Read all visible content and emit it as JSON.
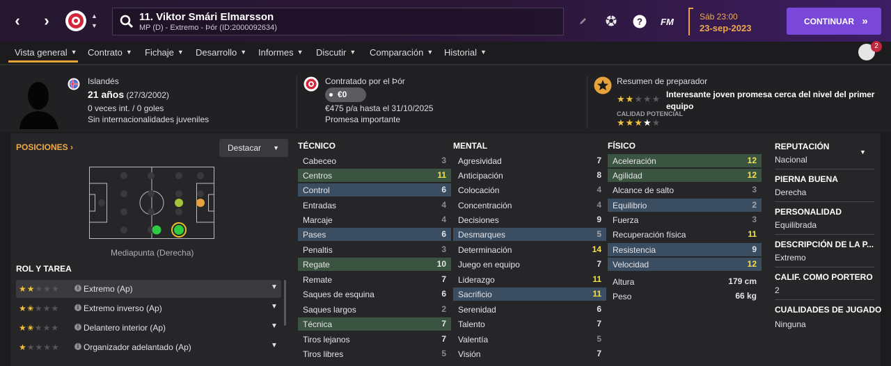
{
  "top": {
    "player_title": "11. Viktor Smári Elmarsson",
    "player_sub": "MP (D) - Extremo - Þór (ID:2000092634)",
    "fm_logo": "FM",
    "date_day": "Sáb 23:00",
    "date_full": "23-sep-2023",
    "continue_label": "CONTINUAR",
    "notifications": "2",
    "colors": {
      "accent": "#7a48d8",
      "date": "#f0a94a"
    }
  },
  "tabs": [
    "Vista general",
    "Contrato",
    "Fichaje",
    "Desarrollo",
    "Informes",
    "Discutir",
    "Comparación",
    "Historial"
  ],
  "info": {
    "nationality": "Islandés",
    "age": "21 años",
    "birth": "(27/3/2002)",
    "caps": "0 veces int. / 0 goles",
    "youth": "Sin internacionalidades juveniles",
    "contracted_by": "Contratado por el Þór",
    "fee": "€0",
    "wage": "€475 p/a hasta el 31/10/2025",
    "status": "Promesa importante",
    "coach_title": "Resumen de preparador",
    "coach_summary": "Interesante joven promesa cerca del nivel del primer equipo",
    "potential_label": "CALIDAD POTENCIAL",
    "current_stars": 2,
    "potential_stars": 3.5
  },
  "positions": {
    "header": "POSICIONES",
    "destacar": "Destacar",
    "label": "Mediapunta (Derecha)"
  },
  "roles": {
    "header": "ROL Y TAREA",
    "items": [
      {
        "name": "Extremo (Ap)",
        "stars": 2
      },
      {
        "name": "Extremo inverso (Ap)",
        "stars": 1.5
      },
      {
        "name": "Delantero interior (Ap)",
        "stars": 1.5
      },
      {
        "name": "Organizador adelantado (Ap)",
        "stars": 1
      }
    ]
  },
  "tecnico": {
    "header": "TÉCNICO",
    "items": [
      {
        "n": "Cabeceo",
        "v": "3"
      },
      {
        "n": "Centros",
        "v": "11"
      },
      {
        "n": "Control",
        "v": "6"
      },
      {
        "n": "Entradas",
        "v": "4"
      },
      {
        "n": "Marcaje",
        "v": "4"
      },
      {
        "n": "Pases",
        "v": "6"
      },
      {
        "n": "Penaltis",
        "v": "3"
      },
      {
        "n": "Regate",
        "v": "10"
      },
      {
        "n": "Remate",
        "v": "7"
      },
      {
        "n": "Saques de esquina",
        "v": "6"
      },
      {
        "n": "Saques largos",
        "v": "2"
      },
      {
        "n": "Técnica",
        "v": "7"
      },
      {
        "n": "Tiros lejanos",
        "v": "7"
      },
      {
        "n": "Tiros libres",
        "v": "5"
      }
    ]
  },
  "mental": {
    "header": "MENTAL",
    "items": [
      {
        "n": "Agresividad",
        "v": "7"
      },
      {
        "n": "Anticipación",
        "v": "8"
      },
      {
        "n": "Colocación",
        "v": "4"
      },
      {
        "n": "Concentración",
        "v": "4"
      },
      {
        "n": "Decisiones",
        "v": "9"
      },
      {
        "n": "Desmarques",
        "v": "5"
      },
      {
        "n": "Determinación",
        "v": "14"
      },
      {
        "n": "Juego en equipo",
        "v": "7"
      },
      {
        "n": "Liderazgo",
        "v": "11"
      },
      {
        "n": "Sacrificio",
        "v": "11"
      },
      {
        "n": "Serenidad",
        "v": "6"
      },
      {
        "n": "Talento",
        "v": "7"
      },
      {
        "n": "Valentía",
        "v": "5"
      },
      {
        "n": "Visión",
        "v": "7"
      }
    ]
  },
  "fisico": {
    "header": "FÍSICO",
    "items": [
      {
        "n": "Aceleración",
        "v": "12"
      },
      {
        "n": "Agilidad",
        "v": "12"
      },
      {
        "n": "Alcance de salto",
        "v": "3"
      },
      {
        "n": "Equilibrio",
        "v": "2"
      },
      {
        "n": "Fuerza",
        "v": "3"
      },
      {
        "n": "Recuperación física",
        "v": "11"
      },
      {
        "n": "Resistencia",
        "v": "9"
      },
      {
        "n": "Velocidad",
        "v": "12"
      }
    ],
    "extra": [
      {
        "n": "Altura",
        "v": "179 cm"
      },
      {
        "n": "Peso",
        "v": "66 kg"
      }
    ]
  },
  "side": [
    {
      "h": "REPUTACIÓN",
      "v": "Nacional"
    },
    {
      "h": "PIERNA BUENA",
      "v": "Derecha"
    },
    {
      "h": "PERSONALIDAD",
      "v": "Equilibrada"
    },
    {
      "h": "DESCRIPCIÓN DE LA P...",
      "v": "Extremo"
    },
    {
      "h": "CALIF. COMO PORTERO",
      "v": "2"
    },
    {
      "h": "CUALIDADES DE JUGADO",
      "v": "Ninguna"
    }
  ]
}
